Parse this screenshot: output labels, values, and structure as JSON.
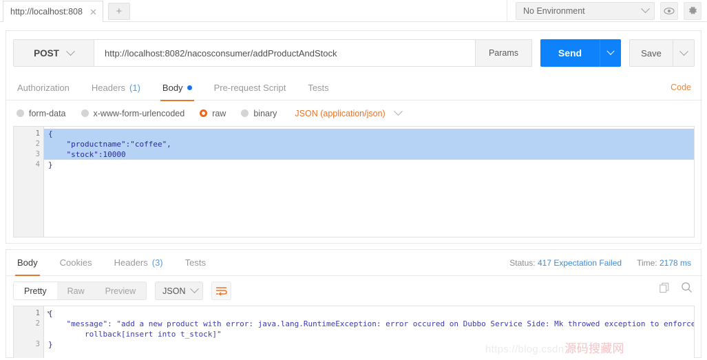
{
  "topbar": {
    "request_tab_label": "http://localhost:808",
    "close_icon": "close-icon",
    "new_tab_label": "+",
    "environment": "No Environment",
    "eye_icon": "eye-icon",
    "gear_icon": "gear-icon"
  },
  "request": {
    "method": "POST",
    "url": "http://localhost:8082/nacosconsumer/addProductAndStock",
    "params_label": "Params",
    "send_label": "Send",
    "save_label": "Save",
    "code_link": "Code",
    "tabs": [
      {
        "label": "Authorization",
        "count": "",
        "active": false,
        "dot": false
      },
      {
        "label": "Headers",
        "count": "(1)",
        "active": false,
        "dot": false
      },
      {
        "label": "Body",
        "count": "",
        "active": true,
        "dot": true
      },
      {
        "label": "Pre-request Script",
        "count": "",
        "active": false,
        "dot": false
      },
      {
        "label": "Tests",
        "count": "",
        "active": false,
        "dot": false
      }
    ],
    "body_types": [
      {
        "label": "form-data",
        "selected": false
      },
      {
        "label": "x-www-form-urlencoded",
        "selected": false
      },
      {
        "label": "raw",
        "selected": true
      },
      {
        "label": "binary",
        "selected": false
      }
    ],
    "content_type": "JSON (application/json)",
    "body_lines": [
      {
        "n": "1",
        "text": "{",
        "selected": true,
        "fold": true
      },
      {
        "n": "2",
        "text": "    \"productname\":\"coffee\",",
        "selected": true,
        "fold": false
      },
      {
        "n": "3",
        "text": "    \"stock\":10000",
        "selected": true,
        "fold": false
      },
      {
        "n": "4",
        "text": "}",
        "selected": false,
        "fold": false
      }
    ]
  },
  "response": {
    "tabs": [
      {
        "label": "Body",
        "count": "",
        "active": true
      },
      {
        "label": "Cookies",
        "count": "",
        "active": false
      },
      {
        "label": "Headers",
        "count": "(3)",
        "active": false
      },
      {
        "label": "Tests",
        "count": "",
        "active": false
      }
    ],
    "status_label": "Status:",
    "status_value": "417 Expectation Failed",
    "time_label": "Time:",
    "time_value": "2178 ms",
    "view_modes": [
      {
        "label": "Pretty",
        "active": true
      },
      {
        "label": "Raw",
        "active": false
      },
      {
        "label": "Preview",
        "active": false
      }
    ],
    "format": "JSON",
    "wrap_icon": "word-wrap-icon",
    "copy_icon": "copy-icon",
    "search_icon": "search-icon",
    "body_lines": [
      {
        "n": "1",
        "text": "{",
        "fold": true
      },
      {
        "n": "2",
        "text": "    \"message\": \"add a new product with error: java.lang.RuntimeException: error occured on Dubbo Service Side: Mk throwed exception to enforce",
        "fold": false
      },
      {
        "n": "",
        "text": "        rollback[insert into t_stock]\"",
        "fold": false
      },
      {
        "n": "3",
        "text": "}",
        "fold": false
      }
    ]
  },
  "watermark": {
    "url": "https://blog.csdn",
    "cn": "源码搜藏网"
  },
  "colors": {
    "send_blue": "#0e82fa",
    "accent_orange": "#e8752c",
    "link_blue": "#3c8dd9",
    "selection": "#b6d2f5"
  }
}
